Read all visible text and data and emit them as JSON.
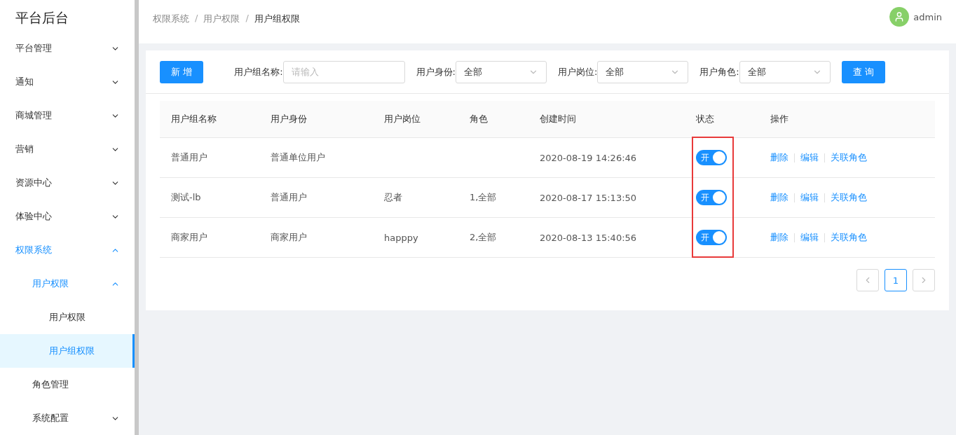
{
  "sidebar": {
    "title": "平台后台",
    "items": [
      {
        "label": "平台管理",
        "expanded": false,
        "selected": false
      },
      {
        "label": "通知",
        "expanded": false,
        "selected": false
      },
      {
        "label": "商城管理",
        "expanded": false,
        "selected": false
      },
      {
        "label": "营销",
        "expanded": false,
        "selected": false
      },
      {
        "label": "资源中心",
        "expanded": false,
        "selected": false
      },
      {
        "label": "体验中心",
        "expanded": false,
        "selected": false
      },
      {
        "label": "权限系统",
        "expanded": true,
        "selected": false,
        "children": [
          {
            "label": "用户权限",
            "expanded": true,
            "selected": false,
            "children": [
              {
                "label": "用户权限",
                "selected": false
              },
              {
                "label": "用户组权限",
                "selected": true
              }
            ]
          },
          {
            "label": "角色管理",
            "selected": false
          },
          {
            "label": "系统配置",
            "expanded": false,
            "selected": false
          }
        ]
      }
    ]
  },
  "breadcrumb": [
    {
      "label": "权限系统",
      "separator": "/"
    },
    {
      "label": "用户权限",
      "separator": "/"
    },
    {
      "label": "用户组权限"
    }
  ],
  "user": {
    "name": "admin"
  },
  "toolbar": {
    "add_button": "新 增",
    "filters": [
      {
        "kind": "input",
        "label": "用户组名称:",
        "placeholder": "请输入"
      },
      {
        "kind": "select",
        "label": "用户身份:",
        "value": "全部"
      },
      {
        "kind": "select",
        "label": "用户岗位:",
        "value": "全部"
      },
      {
        "kind": "select",
        "label": "用户角色:",
        "value": "全部"
      }
    ],
    "search_button": "查 询"
  },
  "table": {
    "columns": [
      {
        "label": "用户组名称"
      },
      {
        "label": "用户身份"
      },
      {
        "label": "用户岗位"
      },
      {
        "label": "角色"
      },
      {
        "label": "创建时间"
      },
      {
        "label": "状态",
        "highlighted": true
      },
      {
        "label": "操作"
      }
    ],
    "rows": [
      {
        "name": "普通用户",
        "identity": "普通单位用户",
        "created": "2020-08-19 14:26:46",
        "status": {
          "on": true,
          "label": "开"
        },
        "actions": [
          "删除",
          "编辑",
          "关联角色"
        ]
      },
      {
        "name": "测试-lb",
        "identity": "普通用户",
        "post": "忍者",
        "role": "1,全部",
        "created": "2020-08-17 15:13:50",
        "status": {
          "on": true,
          "label": "开"
        },
        "actions": [
          "删除",
          "编辑",
          "关联角色"
        ]
      },
      {
        "name": "商家用户",
        "identity": "商家用户",
        "post": "happpy",
        "role": "2,全部",
        "created": "2020-08-13 15:40:56",
        "status": {
          "on": true,
          "label": "开"
        },
        "actions": [
          "删除",
          "编辑",
          "关联角色"
        ]
      }
    ]
  },
  "pagination": {
    "pages": [
      {
        "label": "1",
        "selected": true
      }
    ]
  }
}
